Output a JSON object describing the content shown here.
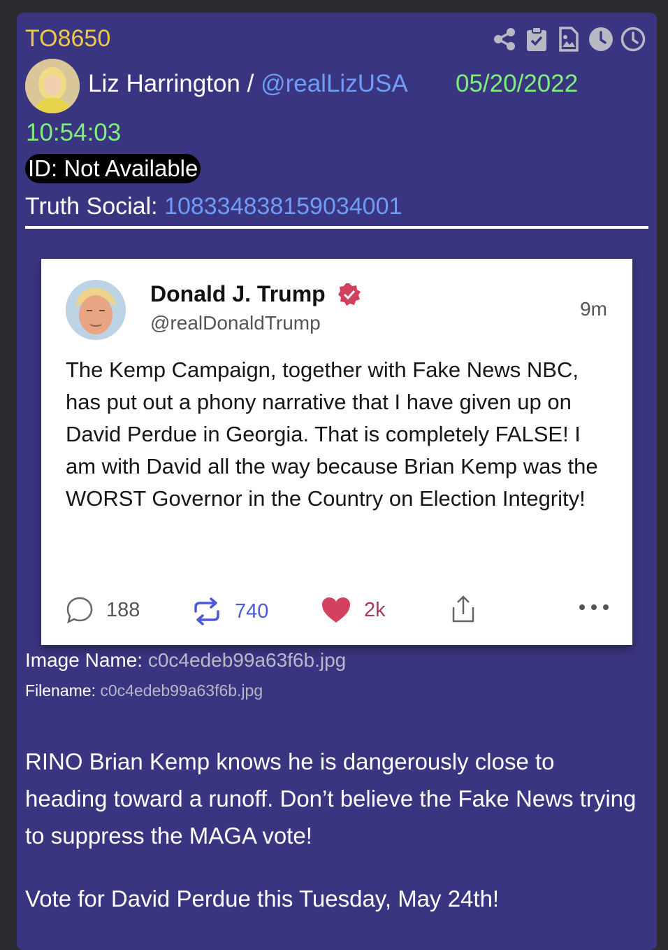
{
  "post": {
    "id": "TO8650",
    "author_name": "Liz Harrington /",
    "author_handle": "@realLizUSA",
    "date": "05/20/2022",
    "time": "10:54:03",
    "id_label": "ID: Not Available",
    "truth_label": "Truth Social:",
    "truth_id": "108334838159034001"
  },
  "toolbar": {
    "icons": [
      "share-icon",
      "clipboard-check-icon",
      "image-file-icon",
      "clock-solid-icon",
      "clock-outline-icon"
    ]
  },
  "screenshot": {
    "name": "Donald J. Trump",
    "handle": "@realDonaldTrump",
    "age": "9m",
    "text": "The Kemp Campaign, together with Fake News NBC, has put out a phony narrative that I have given up on David Perdue in Georgia. That is completely FALSE! I am with David all the way because Brian Kemp was the WORST Governor in the Country on Election Integrity!",
    "replies": "188",
    "reblogs": "740",
    "likes": "2k"
  },
  "image": {
    "name_label": "Image Name:",
    "name_value": "c0c4edeb99a63f6b.jpg",
    "file_label": "Filename:",
    "file_value": "c0c4edeb99a63f6b.jpg"
  },
  "message": {
    "para1": "RINO Brian Kemp knows he is dangerously close to heading toward a runoff. Don’t believe the Fake News trying to suppress the MAGA vote!",
    "para2": "Vote for David Perdue this Tuesday, May 24th!"
  },
  "colors": {
    "card_bg": "#3a3580",
    "post_id": "#f0c94a",
    "timestamp": "#7ef07a",
    "link": "#6f9cf5",
    "icon": "#b9b9c6"
  }
}
